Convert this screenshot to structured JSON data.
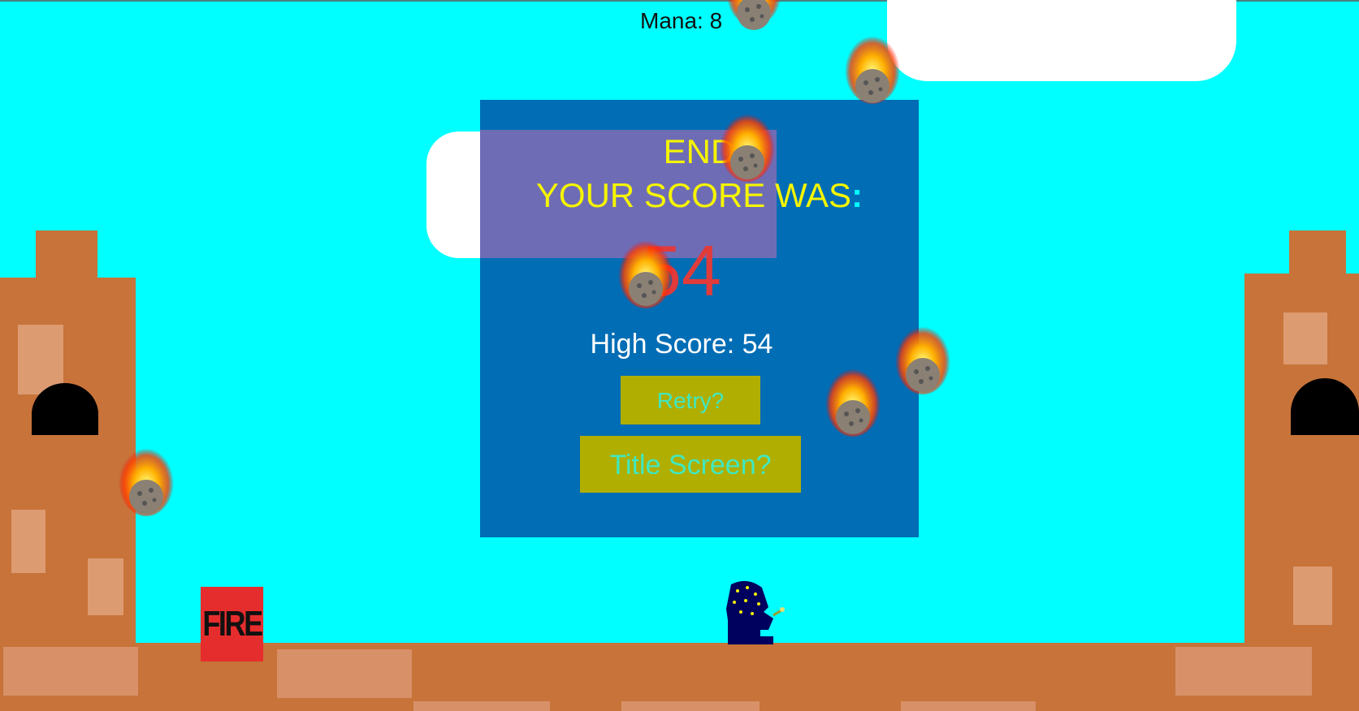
{
  "hud": {
    "mana_label": "Mana: 8"
  },
  "game_over": {
    "end_label": "END",
    "score_label": "YOUR SCORE WAS",
    "score_colon": ":",
    "score_value": "54",
    "high_score_label": "High Score: 54",
    "retry_label": "Retry?",
    "title_screen_label": "Title Screen?"
  },
  "controls": {
    "fire_label": "FIRE"
  },
  "colors": {
    "sky": "#00ffff",
    "panel": "#006db5",
    "title_text": "#f5f500",
    "score_text": "#e03b3b",
    "button_bg": "#b0ae00",
    "button_text": "#40e8c0",
    "fire_button": "#e62d2d",
    "brick": "#c77339"
  },
  "icons": {
    "meteor": "meteor-icon",
    "wizard": "wizard-icon",
    "door": "tower-door"
  }
}
